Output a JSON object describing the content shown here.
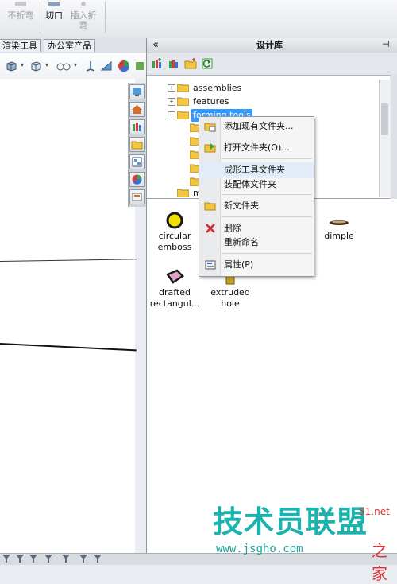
{
  "ribbon": {
    "unfold_label": "不折弯",
    "cut_label": "切口",
    "insert_bend_label_line1": "插入折",
    "insert_bend_label_line2": "弯"
  },
  "left_tabs": [
    "渲染工具",
    "办公室产品"
  ],
  "panel": {
    "collapse_glyph": "«",
    "title": "设计库",
    "pin_glyph": "⊣"
  },
  "tree": {
    "items": [
      {
        "label": "assemblies",
        "expander": "+"
      },
      {
        "label": "features",
        "expander": "+"
      },
      {
        "label": "forming tools",
        "expander": "−",
        "selected": true
      },
      {
        "label": "m",
        "expander": ""
      }
    ]
  },
  "context_menu": {
    "items": [
      {
        "label": "添加现有文件夹...",
        "icon": "add-folder-icon"
      },
      {
        "label": "打开文件夹(O)...",
        "icon": "open-folder-icon"
      },
      {
        "label": "成形工具文件夹",
        "icon": ""
      },
      {
        "label": "装配体文件夹",
        "icon": ""
      },
      {
        "label": "新文件夹",
        "icon": "new-folder-icon"
      },
      {
        "label": "删除",
        "icon": "delete-icon"
      },
      {
        "label": "重新命名",
        "icon": ""
      },
      {
        "label": "属性(P)",
        "icon": "properties-icon"
      }
    ]
  },
  "files": [
    {
      "label_line1": "circular",
      "label_line2": "emboss"
    },
    {
      "label_line1": "dimple",
      "label_line2": ""
    },
    {
      "label_line1": "drafted",
      "label_line2": "rectangul..."
    },
    {
      "label_line1": "extruded",
      "label_line2": "hole"
    }
  ],
  "watermark": {
    "main": "技术员联盟",
    "url": "www.jsgho.com",
    "small": "51.net",
    "home": "之家"
  },
  "colors": {
    "accent": "#3399ff",
    "watermark": "#1bb3ad"
  }
}
